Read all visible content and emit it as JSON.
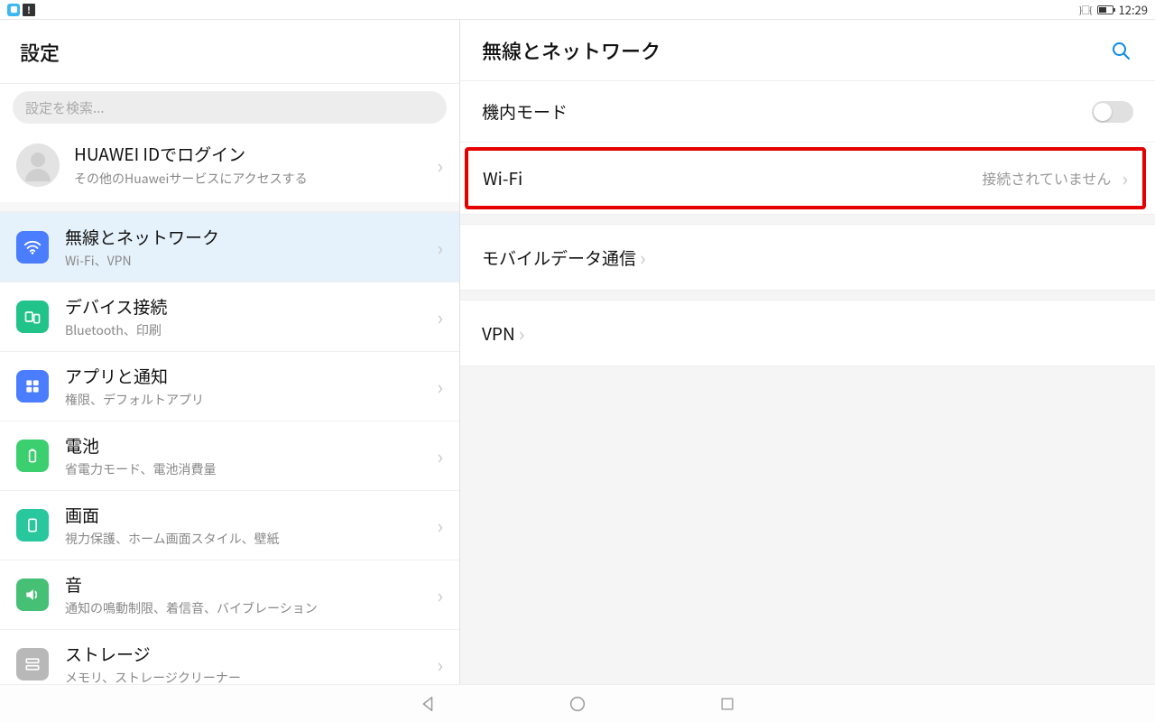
{
  "statusbar": {
    "time": "12:29"
  },
  "sidebar": {
    "title": "設定",
    "search_placeholder": "設定を検索...",
    "login_title": "HUAWEI IDでログイン",
    "login_sub": "その他のHuaweiサービスにアクセスする",
    "items": [
      {
        "title": "無線とネットワーク",
        "sub": "Wi-Fi、VPN"
      },
      {
        "title": "デバイス接続",
        "sub": "Bluetooth、印刷"
      },
      {
        "title": "アプリと通知",
        "sub": "権限、デフォルトアプリ"
      },
      {
        "title": "電池",
        "sub": "省電力モード、電池消費量"
      },
      {
        "title": "画面",
        "sub": "視力保護、ホーム画面スタイル、壁紙"
      },
      {
        "title": "音",
        "sub": "通知の鳴動制限、着信音、バイブレーション"
      },
      {
        "title": "ストレージ",
        "sub": "メモリ、ストレージクリーナー"
      }
    ]
  },
  "main": {
    "title": "無線とネットワーク",
    "airplane_label": "機内モード",
    "wifi_label": "Wi-Fi",
    "wifi_value": "接続されていません",
    "mobile_label": "モバイルデータ通信",
    "vpn_label": "VPN"
  }
}
